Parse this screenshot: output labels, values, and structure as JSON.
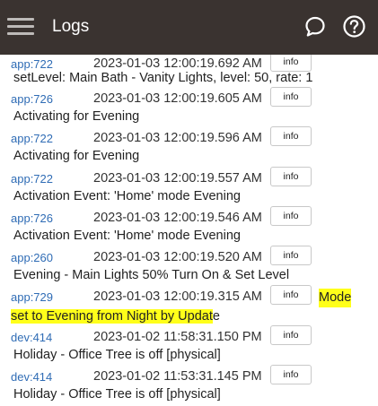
{
  "header": {
    "title": "Logs",
    "background": "#3a3330",
    "icons": [
      "menu-icon",
      "chat-icon",
      "help-icon"
    ]
  },
  "colors": {
    "link": "#2f6cb5",
    "highlight": "#ffff1a"
  },
  "logs": [
    {
      "source": "app:722",
      "timestamp": "2023-01-03 12:00:19.692 AM",
      "level": "info",
      "message": "setLevel: Main Bath - Vanity Lights, level: 50, rate: 1"
    },
    {
      "source": "app:726",
      "timestamp": "2023-01-03 12:00:19.605 AM",
      "level": "info",
      "message": "Activating for Evening"
    },
    {
      "source": "app:722",
      "timestamp": "2023-01-03 12:00:19.596 AM",
      "level": "info",
      "message": "Activating for Evening"
    },
    {
      "source": "app:722",
      "timestamp": "2023-01-03 12:00:19.557 AM",
      "level": "info",
      "message": "Activation Event: 'Home' mode Evening"
    },
    {
      "source": "app:726",
      "timestamp": "2023-01-03 12:00:19.546 AM",
      "level": "info",
      "message": "Activation Event: 'Home' mode Evening"
    },
    {
      "source": "app:260",
      "timestamp": "2023-01-03 12:00:19.520 AM",
      "level": "info",
      "message": "Evening - Main Lights 50% Turn On & Set Level"
    },
    {
      "source": "app:729",
      "timestamp": "2023-01-03 12:00:19.315 AM",
      "level": "info",
      "message_part1": "Mode",
      "message_part2_highlight": "set to Evening from Night by Updat",
      "message_part2_rest": "e"
    },
    {
      "source": "dev:414",
      "timestamp": "2023-01-02 11:58:31.150 PM",
      "level": "info",
      "message": "Holiday - Office Tree is off [physical]"
    },
    {
      "source": "dev:414",
      "timestamp": "2023-01-02 11:53:31.145 PM",
      "level": "info",
      "message": "Holiday - Office Tree is off [physical]"
    }
  ]
}
